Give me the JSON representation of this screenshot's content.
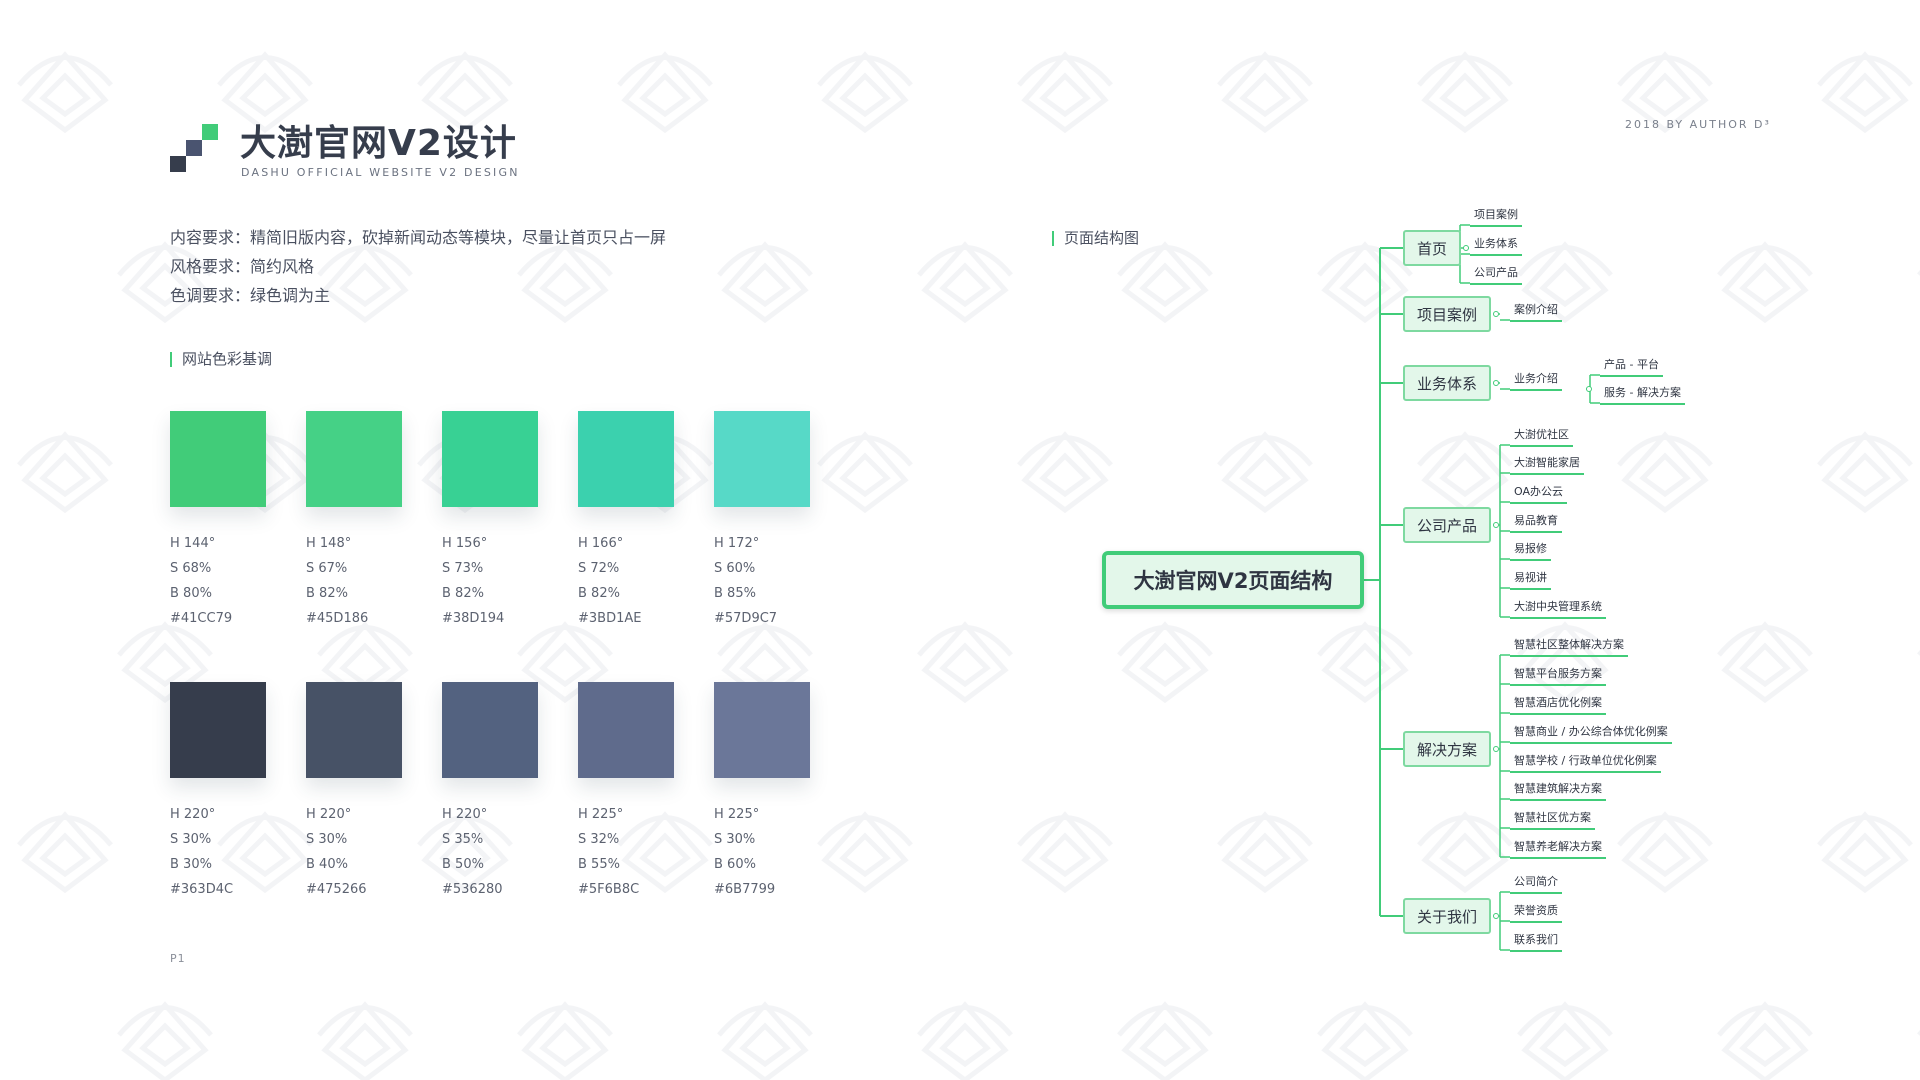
{
  "header": {
    "title": "大澍官网V2设计",
    "subtitle": "DASHU OFFICIAL WEBSITE V2 DESIGN",
    "author": "2018 BY AUTHOR D³"
  },
  "requirements": [
    "内容要求：精简旧版内容，砍掉新闻动态等模块，尽量让首页只占一屏",
    "风格要求：简约风格",
    "色调要求：绿色调为主"
  ],
  "palette": {
    "label": "网站色彩基调",
    "rows": [
      [
        {
          "hex": "#41CC79",
          "h": "H 144°",
          "s": "S 68%",
          "b": "B 80%",
          "code": "#41CC79"
        },
        {
          "hex": "#45D186",
          "h": "H 148°",
          "s": "S 67%",
          "b": "B 82%",
          "code": "#45D186"
        },
        {
          "hex": "#38D194",
          "h": "H 156°",
          "s": "S 73%",
          "b": "B 82%",
          "code": "#38D194"
        },
        {
          "hex": "#3BD1AE",
          "h": "H 166°",
          "s": "S 72%",
          "b": "B 82%",
          "code": "#3BD1AE"
        },
        {
          "hex": "#57D9C7",
          "h": "H 172°",
          "s": "S 60%",
          "b": "B 85%",
          "code": "#57D9C7"
        }
      ],
      [
        {
          "hex": "#363D4C",
          "h": "H 220°",
          "s": "S 30%",
          "b": "B 30%",
          "code": "#363D4C"
        },
        {
          "hex": "#475266",
          "h": "H 220°",
          "s": "S 30%",
          "b": "B 40%",
          "code": "#475266"
        },
        {
          "hex": "#536280",
          "h": "H 220°",
          "s": "S 35%",
          "b": "B 50%",
          "code": "#536280"
        },
        {
          "hex": "#5F6B8C",
          "h": "H 225°",
          "s": "S 32%",
          "b": "B 55%",
          "code": "#5F6B8C"
        },
        {
          "hex": "#6B7799",
          "h": "H 225°",
          "s": "S 30%",
          "b": "B 60%",
          "code": "#6B7799"
        }
      ]
    ]
  },
  "page_number": "P1",
  "structure": {
    "label": "页面结构图",
    "root": "大澍官网V2页面结构",
    "branches": [
      {
        "label": "首页",
        "children": [
          "项目案例",
          "业务体系",
          "公司产品"
        ]
      },
      {
        "label": "项目案例",
        "children": [
          "案例介绍"
        ]
      },
      {
        "label": "业务体系",
        "children": [
          "业务介绍"
        ],
        "grandchildren": [
          "产品 - 平台",
          "服务 - 解决方案"
        ]
      },
      {
        "label": "公司产品",
        "children": [
          "大澍优社区",
          "大澍智能家居",
          "OA办公云",
          "易品教育",
          "易报修",
          "易视讲",
          "大澍中央管理系统"
        ]
      },
      {
        "label": "解决方案",
        "children": [
          "智慧社区整体解决方案",
          "智慧平台服务方案",
          "智慧酒店优化例案",
          "智慧商业 / 办公综合体优化例案",
          "智慧学校 / 行政单位优化例案",
          "智慧建筑解决方案",
          "智慧社区优方案",
          "智慧养老解决方案"
        ]
      },
      {
        "label": "关于我们",
        "children": [
          "公司简介",
          "荣誉资质",
          "联系我们"
        ]
      }
    ]
  },
  "colors": {
    "accent": "#41CC79",
    "logo_dark": "#363D4C",
    "logo_mid": "#536280"
  }
}
